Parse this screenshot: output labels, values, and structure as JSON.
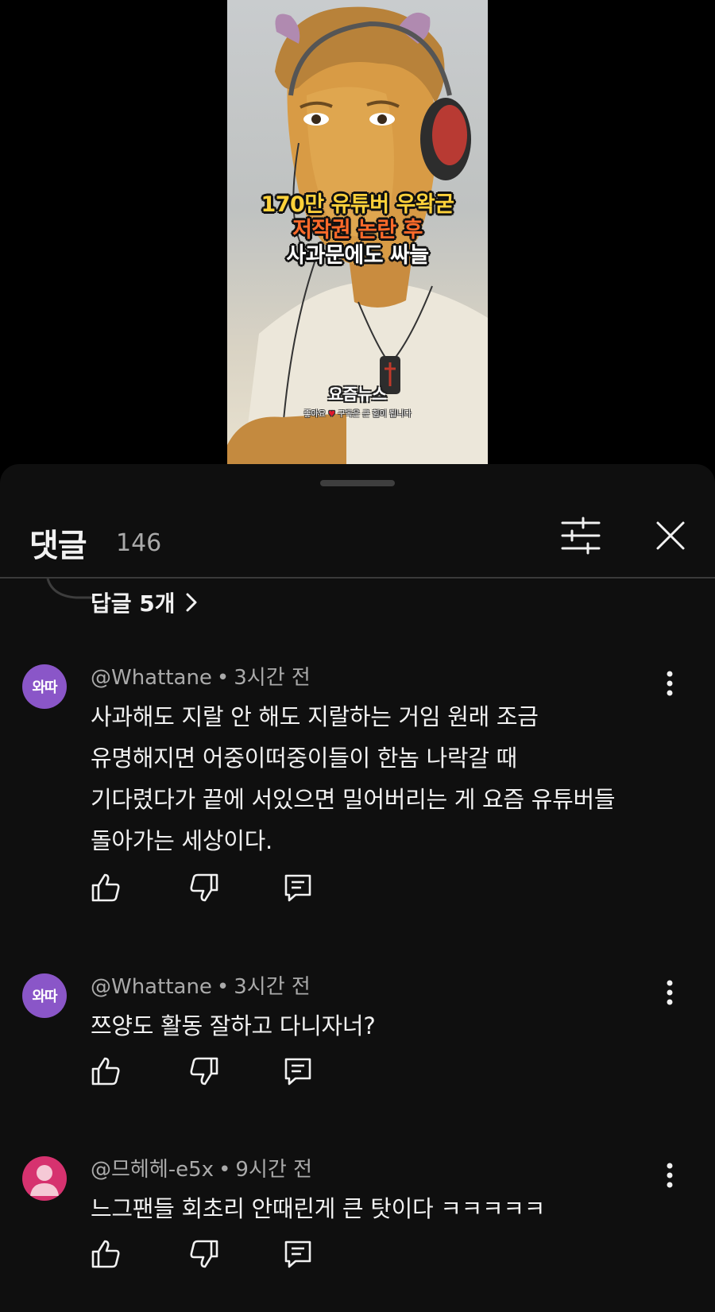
{
  "video": {
    "overlay_lines": [
      "170만 유튜버 우왁굳",
      "저작권 논란 후",
      "사과문에도 싸늘"
    ],
    "channel_brand": "요즘뉴스",
    "brand_sub_before": "좋아요",
    "brand_sub_after": "구독은 큰 힘이 됩니다"
  },
  "sheet": {
    "title": "댓글",
    "count": "146"
  },
  "replies_link": {
    "label": "답글 5개"
  },
  "comments": [
    {
      "avatar_text": "와따",
      "author": "@Whattane",
      "time": "3시간 전",
      "lines": [
        "사과해도 지랄 안 해도 지랄하는 거임 원래 조금",
        "유명해지면 어중이떠중이들이 한놈 나락갈 때",
        "기다렸다가 끝에 서있으면 밀어버리는 게 요즘 유튜버들",
        "돌아가는 세상이다."
      ]
    },
    {
      "avatar_text": "와따",
      "author": "@Whattane",
      "time": "3시간 전",
      "lines": [
        "쯔양도 활동 잘하고 다니자너?"
      ]
    },
    {
      "avatar_text": "",
      "author": "@므헤헤-e5x",
      "time": "9시간 전",
      "lines": [
        "느그팬들 회초리 안때린게 큰 탓이다 ㅋㅋㅋㅋㅋ"
      ]
    }
  ],
  "colors": {
    "sheet_bg": "#0f0f0f",
    "avatar_purple": "#8a56c8",
    "avatar_pink": "#d6326f",
    "overlay_yellow": "#ffd23a",
    "overlay_orange": "#ff6a2a"
  }
}
